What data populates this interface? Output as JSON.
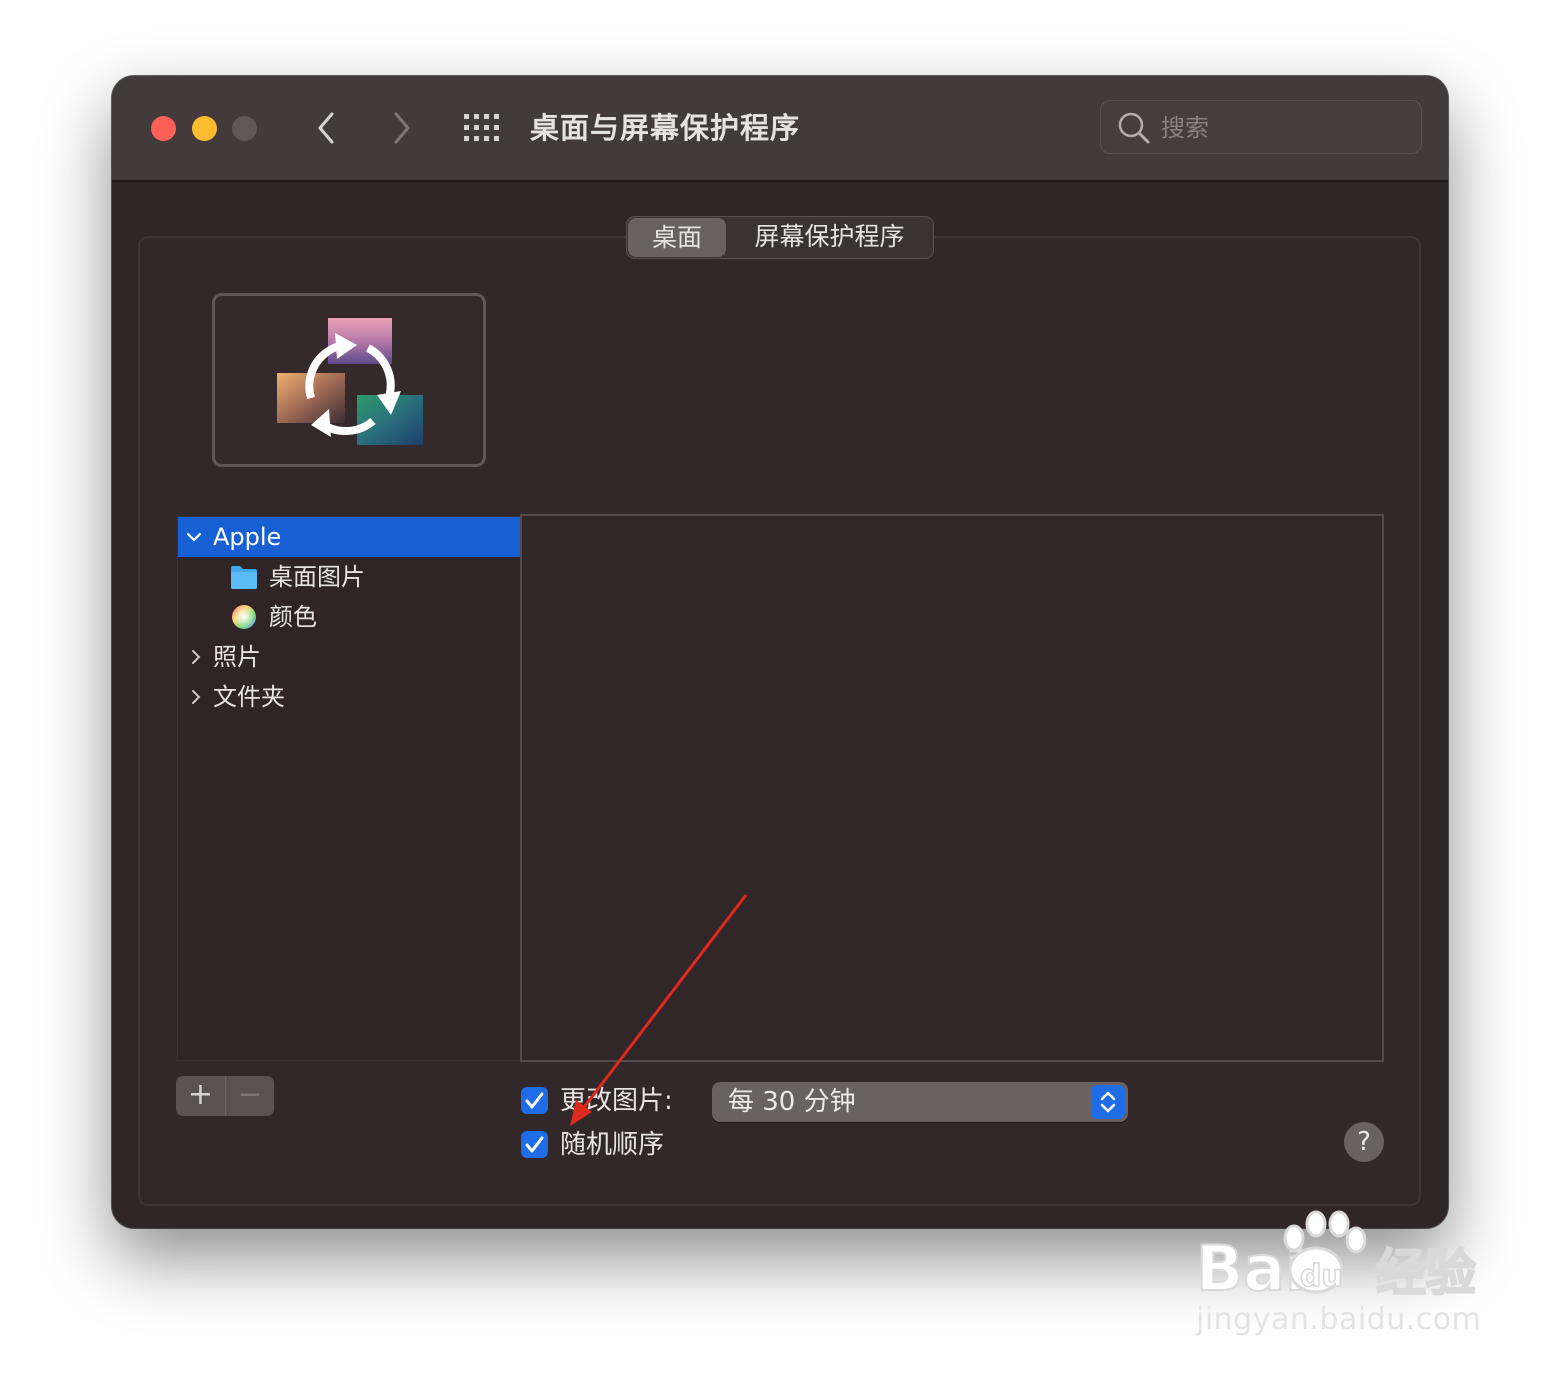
{
  "window": {
    "title": "桌面与屏幕保护程序",
    "search_placeholder": "搜索"
  },
  "tabs": [
    {
      "label": "桌面",
      "active": true
    },
    {
      "label": "屏幕保护程序",
      "active": false
    }
  ],
  "sources": [
    {
      "label": "Apple",
      "expanded": true,
      "selected": true
    },
    {
      "label": "桌面图片",
      "icon": "folder-icon"
    },
    {
      "label": "颜色",
      "icon": "color-wheel-icon"
    },
    {
      "label": "照片",
      "expanded": false
    },
    {
      "label": "文件夹",
      "expanded": false
    }
  ],
  "bottom": {
    "add_label": "+",
    "remove_label": "−",
    "change_picture_label": "更改图片:",
    "change_picture_checked": true,
    "interval_value": "每 30 分钟",
    "random_order_label": "随机顺序",
    "random_order_checked": true,
    "help_label": "?"
  },
  "watermark": {
    "logo_text": "Bai du 经验",
    "url": "jingyan.baidu.com"
  },
  "colors": {
    "accent": "#1e6ce6",
    "selection": "#1760d4",
    "annotation_arrow": "#e0291d"
  }
}
